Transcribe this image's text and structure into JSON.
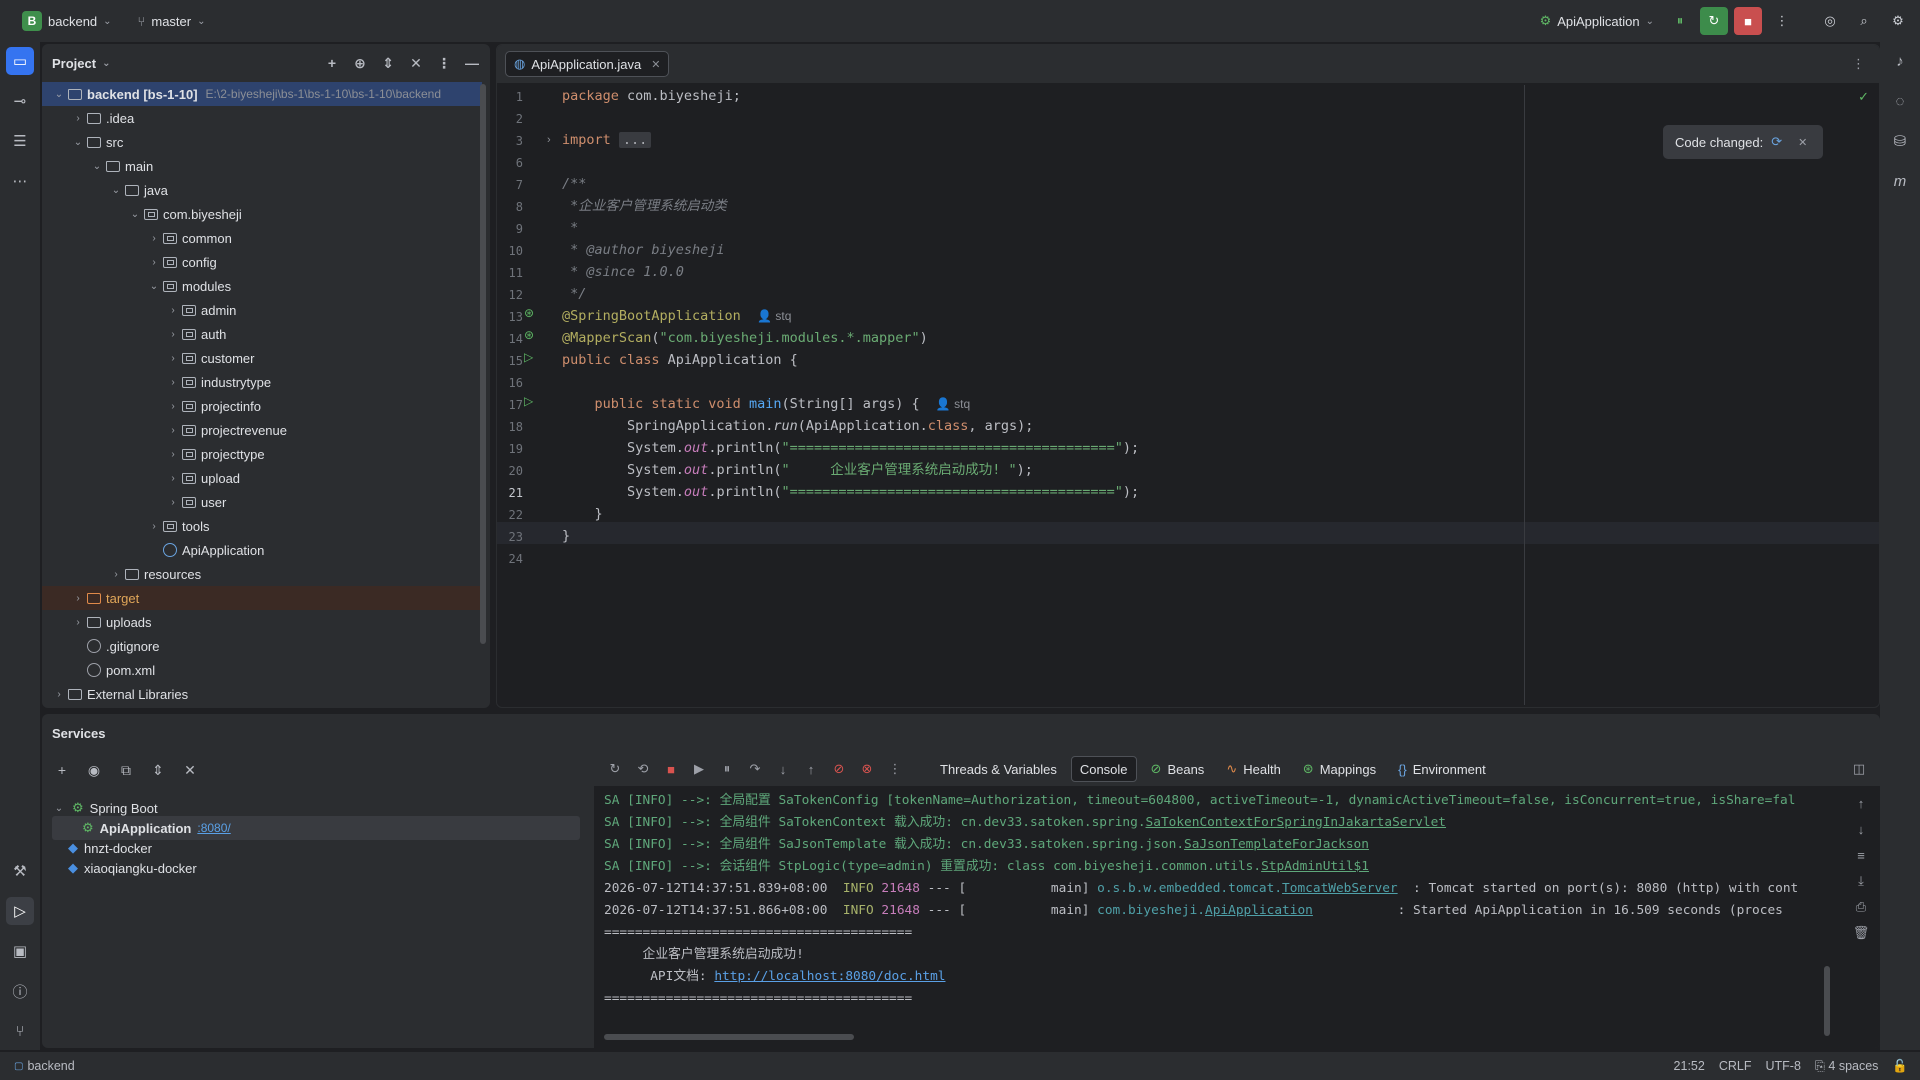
{
  "titlebar": {
    "project_initial": "B",
    "project_name": "backend",
    "branch": "master",
    "run_config": "ApiApplication"
  },
  "project_panel": {
    "title": "Project",
    "tree": [
      {
        "label": "backend [bs-1-10]",
        "hint": "E:\\2-biyesheji\\bs-1\\bs-1-10\\bs-1-10\\backend",
        "depth": 0,
        "expanded": true,
        "kind": "root"
      },
      {
        "label": ".idea",
        "depth": 1,
        "expanded": false,
        "kind": "folder"
      },
      {
        "label": "src",
        "depth": 1,
        "expanded": true,
        "kind": "folder"
      },
      {
        "label": "main",
        "depth": 2,
        "expanded": true,
        "kind": "folder"
      },
      {
        "label": "java",
        "depth": 3,
        "expanded": true,
        "kind": "folder"
      },
      {
        "label": "com.biyesheji",
        "depth": 4,
        "expanded": true,
        "kind": "pkg"
      },
      {
        "label": "common",
        "depth": 5,
        "expanded": false,
        "kind": "pkg"
      },
      {
        "label": "config",
        "depth": 5,
        "expanded": false,
        "kind": "pkg"
      },
      {
        "label": "modules",
        "depth": 5,
        "expanded": true,
        "kind": "pkg"
      },
      {
        "label": "admin",
        "depth": 6,
        "expanded": false,
        "kind": "pkg"
      },
      {
        "label": "auth",
        "depth": 6,
        "expanded": false,
        "kind": "pkg"
      },
      {
        "label": "customer",
        "depth": 6,
        "expanded": false,
        "kind": "pkg"
      },
      {
        "label": "industrytype",
        "depth": 6,
        "expanded": false,
        "kind": "pkg"
      },
      {
        "label": "projectinfo",
        "depth": 6,
        "expanded": false,
        "kind": "pkg"
      },
      {
        "label": "projectrevenue",
        "depth": 6,
        "expanded": false,
        "kind": "pkg"
      },
      {
        "label": "projecttype",
        "depth": 6,
        "expanded": false,
        "kind": "pkg"
      },
      {
        "label": "upload",
        "depth": 6,
        "expanded": false,
        "kind": "pkg"
      },
      {
        "label": "user",
        "depth": 6,
        "expanded": false,
        "kind": "pkg"
      },
      {
        "label": "tools",
        "depth": 5,
        "expanded": false,
        "kind": "pkg"
      },
      {
        "label": "ApiApplication",
        "depth": 5,
        "kind": "class"
      },
      {
        "label": "resources",
        "depth": 3,
        "expanded": false,
        "kind": "folder"
      },
      {
        "label": "target",
        "depth": 1,
        "expanded": false,
        "kind": "excluded"
      },
      {
        "label": "uploads",
        "depth": 1,
        "expanded": false,
        "kind": "folder"
      },
      {
        "label": ".gitignore",
        "depth": 1,
        "kind": "file"
      },
      {
        "label": "pom.xml",
        "depth": 1,
        "kind": "file"
      },
      {
        "label": "External Libraries",
        "depth": 0,
        "expanded": false,
        "kind": "lib"
      }
    ]
  },
  "editor": {
    "tab_label": "ApiApplication.java",
    "toast": "Code changed:",
    "current_line": 21,
    "line_numbers": [
      "1",
      "2",
      "3",
      "6",
      "7",
      "8",
      "9",
      "10",
      "11",
      "12",
      "13",
      "14",
      "15",
      "16",
      "17",
      "18",
      "19",
      "20",
      "21",
      "22",
      "23",
      "24"
    ],
    "code": {
      "l1_kw": "package",
      "l1_rest": " com.biyesheji;",
      "l3_kw": "import",
      "l3_fold": "...",
      "l7": "/**",
      "l8": " *企业客户管理系统启动类",
      "l9": " *",
      "l10_tag": " * @author",
      "l10_rest": " biyesheji",
      "l11_tag": " * @since",
      "l11_rest": " 1.0.0",
      "l12": " */",
      "l13_ann": "@SpringBootApplication",
      "author_hint": "stq",
      "l14_ann": "@MapperScan",
      "l14_open": "(",
      "l14_str": "\"com.biyesheji.modules.*.mapper\"",
      "l14_close": ")",
      "l15_kw": "public class",
      "l15_rest": " ApiApplication {",
      "l17_kw": "    public static void",
      "l17_fn": " main",
      "l17_rest": "(String[] args) {",
      "l18_a": "        SpringApplication.",
      "l18_run": "run",
      "l18_b": "(ApiApplication.",
      "l18_class": "class",
      "l18_c": ", args);",
      "sys": "        System.",
      "out": "out",
      "println": ".println(",
      "l19_str": "\"========================================\"",
      "l20_str": "\"     企业客户管理系统启动成功! \"",
      "l21_str": "\"========================================\"",
      "close_paren": ");",
      "l22": "    }",
      "l23": "}"
    }
  },
  "services": {
    "title": "Services",
    "tree": {
      "group": "Spring Boot",
      "app": "ApiApplication",
      "port": ":8080/",
      "docker1": "hnzt-docker",
      "docker2": "xiaoqiangku-docker"
    },
    "tabs": [
      "Threads & Variables",
      "Console",
      "Beans",
      "Health",
      "Mappings",
      "Environment"
    ],
    "console": {
      "l1": "SA [INFO] -->: 全局配置 SaTokenConfig [tokenName=Authorization, timeout=604800, activeTimeout=-1, dynamicActiveTimeout=false, isConcurrent=true, isShare=fal",
      "l2a": "SA [INFO] -->: 全局组件 SaTokenContext 载入成功: cn.dev33.satoken.spring.",
      "l2b": "SaTokenContextForSpringInJakartaServlet",
      "l3a": "SA [INFO] -->: 全局组件 SaJsonTemplate 载入成功: cn.dev33.satoken.spring.json.",
      "l3b": "SaJsonTemplateForJackson",
      "l4a": "SA [INFO] -->: 会话组件 StpLogic(type=admin) 重置成功: class com.biyesheji.common.utils.",
      "l4b": "StpAdminUtil$1",
      "l5_time": "2026-07-12T14:37:51.839+08:00",
      "l5_level": "INFO",
      "l5_pid": "21648",
      "l5_mid": " --- [           main] ",
      "l5_cls_a": "o.s.b.w.embedded.tomcat.",
      "l5_cls_b": "TomcatWebServer",
      "l5_msg": "  : Tomcat started on port(s): 8080 (http) with cont",
      "l6_time": "2026-07-12T14:37:51.866+08:00",
      "l6_level": "INFO",
      "l6_pid": "21648",
      "l6_mid": " --- [           main] ",
      "l6_cls_a": "com.biyesheji.",
      "l6_cls_b": "ApiApplication",
      "l6_msg": "           : Started ApiApplication in 16.509 seconds (proces",
      "l7": "========================================",
      "l8": "     企业客户管理系统启动成功!",
      "l9a": "      API文档: ",
      "l9b": "http://localhost:8080/doc.html",
      "l10": "========================================"
    }
  },
  "statusbar": {
    "project": "backend",
    "position": "21:52",
    "line_sep": "CRLF",
    "encoding": "UTF-8",
    "indent": "4 spaces"
  }
}
